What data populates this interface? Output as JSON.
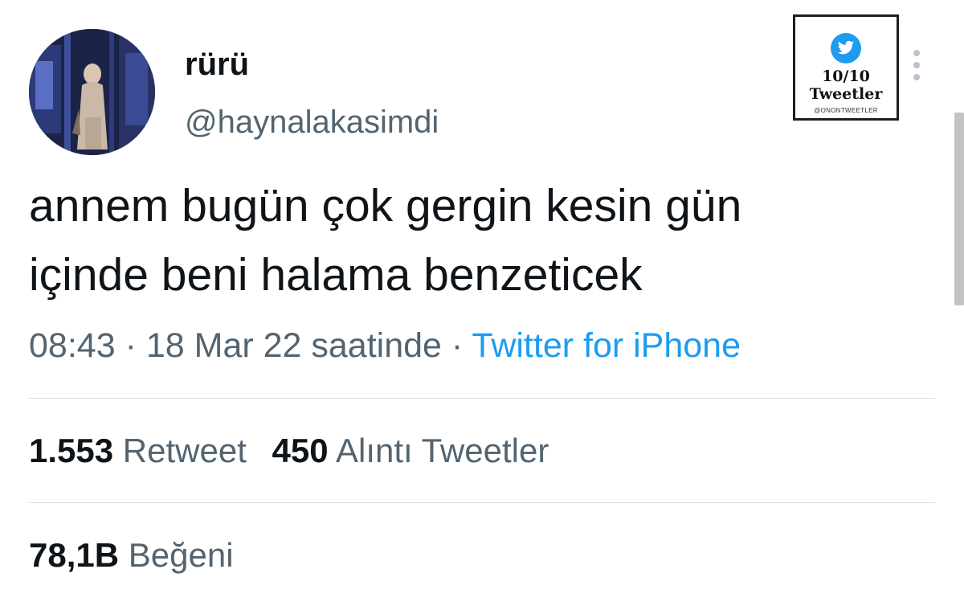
{
  "author": {
    "display_name": "rürü",
    "handle": "@haynalakasimdi"
  },
  "tweet": {
    "line1": "annem bugün çok gergin kesin gün",
    "line2": "içinde beni halama benzeticek",
    "time": "08:43",
    "date": "18 Mar 22 saatinde",
    "separator": "·",
    "source": "Twitter for iPhone"
  },
  "stats": {
    "retweet_count": "1.553",
    "retweet_label": "Retweet",
    "quote_count": "450",
    "quote_label": "Alıntı Tweetler",
    "like_count": "78,1B",
    "like_label": "Beğeni"
  },
  "watermark": {
    "title": "10/10",
    "subtitle": "Tweetler",
    "handle": "@ONONTWEETLER",
    "icon": "twitter-bird-icon"
  },
  "icons": {
    "more": "more-vertical-icon"
  },
  "colors": {
    "link": "#1d9bf0",
    "secondary_text": "#536471",
    "primary_text": "#0f1419"
  }
}
